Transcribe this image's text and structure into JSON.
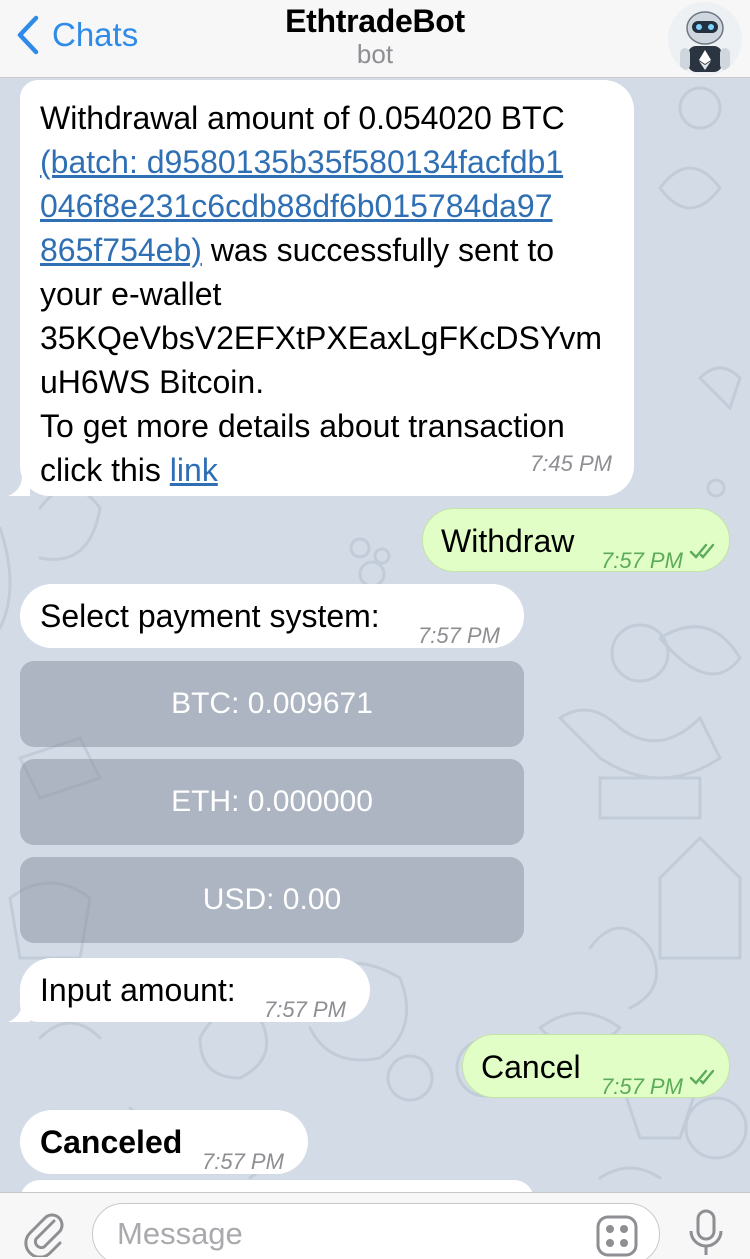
{
  "header": {
    "back_label": "Chats",
    "title": "EthtradeBot",
    "subtitle": "bot"
  },
  "messages": {
    "withdrawal": {
      "line1": "Withdrawal amount of 0.054020 BTC",
      "batch_link": "(batch: d9580135b35f580134facfdb1 046f8e231c6cdb88df6b015784da97 865f754eb)",
      "text_after_link": " was successfully sent to your e-wallet 35KQeVbsV2EFXtPXEaxLgFKcDSYvm uH6WS Bitcoin.",
      "text_details": "To get more details about transaction click this ",
      "details_link": "link",
      "time": "7:45 PM"
    },
    "withdraw_out": {
      "text": "Withdraw",
      "time": "7:57 PM"
    },
    "select_payment": {
      "text": "Select payment system:",
      "time": "7:57 PM"
    },
    "keyboard": [
      {
        "label": "BTC: 0.009671"
      },
      {
        "label": "ETH: 0.000000"
      },
      {
        "label": "USD: 0.00"
      }
    ],
    "input_amount": {
      "text": "Input amount:",
      "time": "7:57 PM"
    },
    "cancel_out": {
      "text": "Cancel",
      "time": "7:57 PM"
    },
    "canceled": {
      "text": "Canceled",
      "time": "7:57 PM"
    }
  },
  "input_bar": {
    "placeholder": "Message"
  },
  "colors": {
    "accent": "#2f8be8",
    "incoming_bubble": "#ffffff",
    "outgoing_bubble": "#e1fec6",
    "read_check": "#5bab5a",
    "chat_background": "#d3dbe7"
  },
  "icons": {
    "back": "chevron-left-icon",
    "attach": "paperclip-icon",
    "sticker": "sticker-grid-icon",
    "mic": "microphone-icon",
    "read": "double-check-icon"
  }
}
